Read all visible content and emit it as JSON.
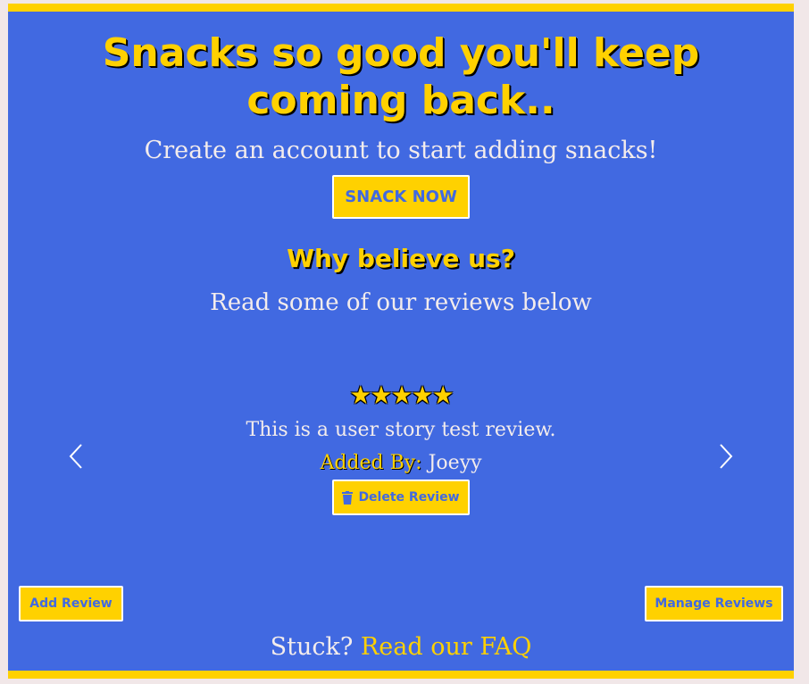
{
  "hero": {
    "headline": "Snacks so good you'll keep coming back..",
    "subhead": "Create an account to start adding snacks!",
    "cta_label": "SNACK NOW"
  },
  "reviews_section": {
    "title": "Why believe us?",
    "intro": "Read some of our reviews below"
  },
  "review": {
    "rating": 5,
    "star_glyph": "★★★★★",
    "text": "This is a user story test review.",
    "added_by_label": "Added By:",
    "added_by_user": "Joeyy",
    "delete_label": "Delete Review"
  },
  "carousel": {
    "prev_icon": "chevron-left-icon",
    "next_icon": "chevron-right-icon"
  },
  "actions": {
    "add_review_label": "Add Review",
    "manage_reviews_label": "Manage Reviews"
  },
  "footer": {
    "stuck_text": "Stuck?",
    "faq_link_text": "Read our FAQ"
  },
  "colors": {
    "panel_background": "#4169e1",
    "accent_yellow": "#ffd100",
    "page_background": "#f1e7e8"
  }
}
